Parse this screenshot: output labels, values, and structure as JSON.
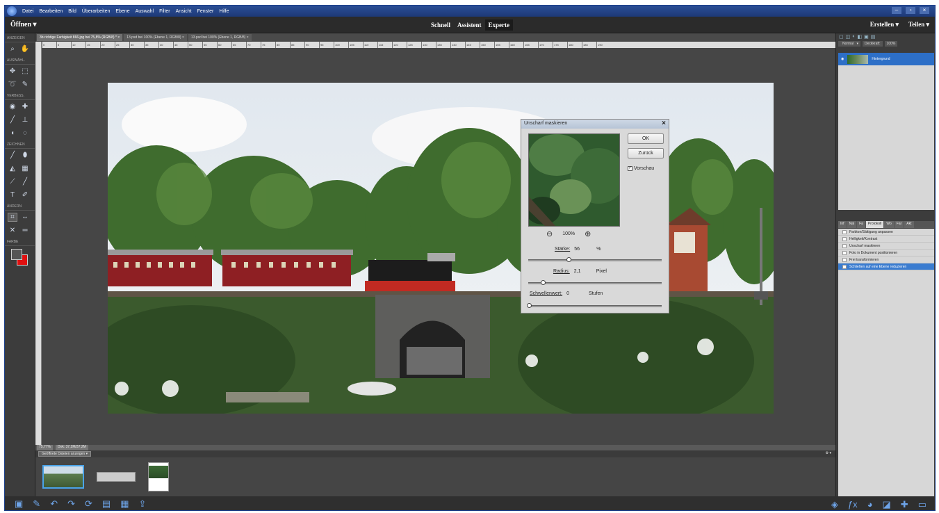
{
  "menubar": {
    "items": [
      "Datei",
      "Bearbeiten",
      "Bild",
      "Überarbeiten",
      "Ebene",
      "Auswahl",
      "Filter",
      "Ansicht",
      "Fenster",
      "Hilfe"
    ]
  },
  "modebar": {
    "open_label": "Öffnen",
    "modes": [
      "Schnell",
      "Assistent",
      "Experte"
    ],
    "active_mode": "Experte",
    "create_label": "Erstellen",
    "share_label": "Teilen"
  },
  "toolbox": {
    "sections": [
      "ANZEIGEN",
      "AUSWÄHL.",
      "VERBESS.",
      "ZEICHNEN",
      "ÄNDERN",
      "FARBE"
    ]
  },
  "doc_tabs": [
    "3b richtige Farbigkeit 866.jpg bei 75,8% (RGB/8) *",
    "13.psd bei 100% (Ebene 1, RGB/8)",
    "13.psd bei 100% (Ebene 1, RGB/8)"
  ],
  "ruler_labels": [
    "0",
    "5",
    "10",
    "15",
    "20",
    "25",
    "30",
    "35",
    "40",
    "45",
    "50",
    "55",
    "60",
    "65",
    "70",
    "75",
    "80",
    "85",
    "90",
    "95",
    "100",
    "105",
    "110",
    "115",
    "120",
    "125",
    "130",
    "135",
    "140",
    "145",
    "150",
    "155",
    "160",
    "165",
    "170",
    "175",
    "180",
    "185",
    "190"
  ],
  "dialog": {
    "title": "Unscharf maskieren",
    "ok_label": "OK",
    "back_label": "Zurück",
    "preview_label": "Vorschau",
    "preview_checked": true,
    "zoom": "100%",
    "strength_label": "Stärke:",
    "strength_value": "56",
    "strength_unit": "%",
    "radius_label": "Radius:",
    "radius_value": "2,1",
    "radius_unit": "Pixel",
    "threshold_label": "Schwellenwert:",
    "threshold_value": "0",
    "threshold_unit": "Stufen"
  },
  "layers": {
    "blend_mode": "Normal",
    "opacity_label": "Deckkraft:",
    "opacity_value": "100%",
    "layer_name": "Hintergrund"
  },
  "history": {
    "tabs": [
      "Inf",
      "Nal",
      "Fa",
      "Protokoll",
      "Wo",
      "Far",
      "Akt"
    ],
    "active_tab": "Protokoll",
    "items": [
      "Farbton/Sättigung anpassen",
      "Helligkeit/Kontrast",
      "Unscharf maskieren",
      "Foto in Dokument positionieren",
      "Frei transformieren",
      "Schließen auf eine Ebene reduzieren"
    ],
    "selected_index": 5
  },
  "status": {
    "zoom": "75,77%",
    "doc": "Dok: 37,2M/37,2M"
  },
  "bin": {
    "filter_label": "Geöffnete Dateien anzeigen"
  }
}
